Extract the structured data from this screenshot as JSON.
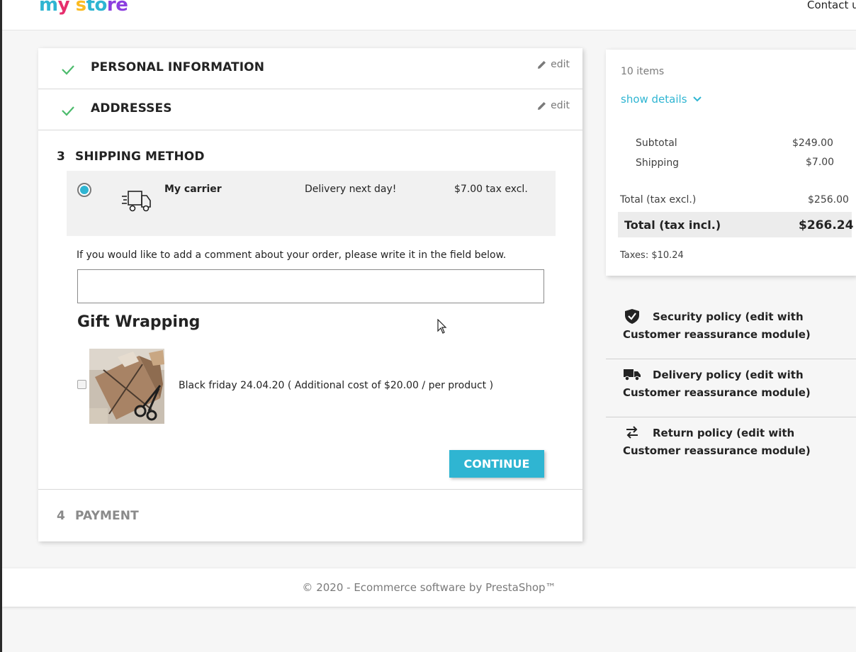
{
  "header": {
    "logo_parts": [
      "m",
      "y",
      " s",
      "to",
      "re"
    ],
    "contact": "Contact u"
  },
  "checkout": {
    "steps": [
      {
        "number": "",
        "title": "PERSONAL INFORMATION",
        "edit": "edit",
        "status": "complete"
      },
      {
        "number": "",
        "title": "ADDRESSES",
        "edit": "edit",
        "status": "complete"
      },
      {
        "number": "3",
        "title": "SHIPPING METHOD",
        "status": "current"
      },
      {
        "number": "4",
        "title": "PAYMENT",
        "status": "pending"
      }
    ],
    "carrier": {
      "name": "My carrier",
      "delay": "Delivery next day!",
      "price": "$7.00 tax excl.",
      "selected": true
    },
    "comment_label": "If you would like to add a comment about your order, please write it in the field below.",
    "comment_value": "",
    "gift": {
      "title": "Gift Wrapping",
      "option_text": "Black friday 24.04.20 ( Additional cost of $20.00 / per product )",
      "checked": false
    },
    "continue_label": "CONTINUE"
  },
  "summary": {
    "items_count": "10 items",
    "show_details": "show details",
    "subtotal_label": "Subtotal",
    "subtotal_value": "$249.00",
    "shipping_label": "Shipping",
    "shipping_value": "$7.00",
    "total_excl_label": "Total (tax excl.)",
    "total_excl_value": "$256.00",
    "total_incl_label": "Total (tax incl.)",
    "total_incl_value": "$266.24",
    "taxes": "Taxes: $10.24"
  },
  "reassurance": [
    {
      "icon": "shield-icon",
      "text": "Security policy (edit with Customer reassurance module)"
    },
    {
      "icon": "truck-icon",
      "text": "Delivery policy (edit with Customer reassurance module)"
    },
    {
      "icon": "swap-arrows-icon",
      "text": "Return policy (edit with Customer reassurance module)"
    }
  ],
  "footer": {
    "copyright": "© 2020 - Ecommerce software by PrestaShop™"
  },
  "colors": {
    "accent": "#2fb5d2",
    "check": "#4cbb6c",
    "muted": "#7a7a7a"
  }
}
